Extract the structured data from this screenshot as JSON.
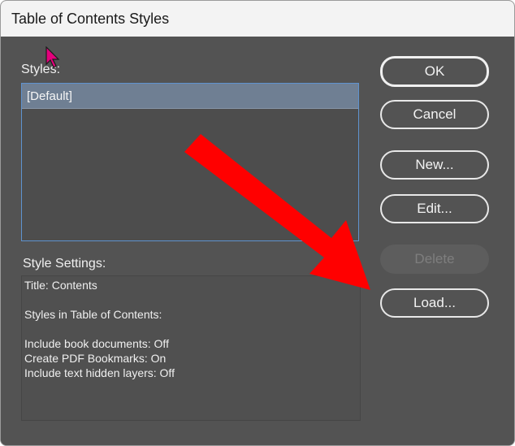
{
  "window": {
    "title": "Table of Contents Styles"
  },
  "styles": {
    "label": "Styles:",
    "items": [
      "[Default]"
    ]
  },
  "style_settings": {
    "label": "Style Settings:",
    "lines": [
      "Title: Contents",
      "",
      "Styles in Table of Contents:",
      "",
      "Include book documents: Off",
      "Create PDF Bookmarks: On",
      "Include text hidden layers: Off"
    ]
  },
  "buttons": {
    "ok": "OK",
    "cancel": "Cancel",
    "new": "New...",
    "edit": "Edit...",
    "delete": "Delete",
    "load": "Load..."
  },
  "annotation": {
    "arrow_color": "#ff0000",
    "cursor_color": "#e4007c"
  }
}
